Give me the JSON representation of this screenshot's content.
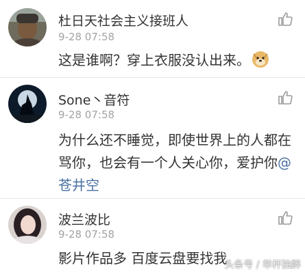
{
  "comments": [
    {
      "username": "杜日天社会主义接班人",
      "time": "9-28 07:58",
      "text": "这是谁啊？穿上衣服没认出来。",
      "emoji": "doge-emoji"
    },
    {
      "username": "Sone丶音符",
      "time": "9-28 07:58",
      "text": "为什么还不睡觉，即使世界上的人都在骂你，也会有一个人关心你，爱护你",
      "mention": "@苍井空"
    },
    {
      "username": "波兰波比",
      "time": "9-28 07:58",
      "text": "影片作品多 百度云盘要找我"
    }
  ],
  "watermark": "头条号 / 举杯独醉",
  "icons": {
    "like": "thumbs-up-icon"
  },
  "colors": {
    "mention": "#4a6fa0",
    "time": "#a3a3a3",
    "text": "#333333"
  }
}
